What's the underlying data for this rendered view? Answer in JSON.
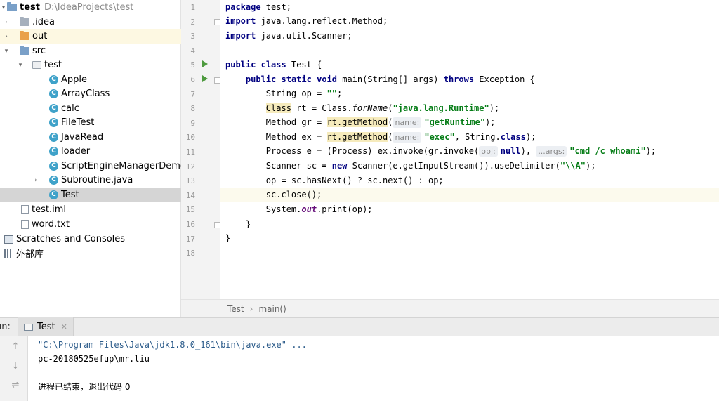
{
  "project_tree": {
    "root": {
      "name": "test",
      "path": "D:\\IdeaProjects\\test"
    },
    "items": [
      {
        "label": ".idea"
      },
      {
        "label": "out"
      },
      {
        "label": "src"
      },
      {
        "label": "test"
      },
      {
        "label": "Apple"
      },
      {
        "label": "ArrayClass"
      },
      {
        "label": "calc"
      },
      {
        "label": "FileTest"
      },
      {
        "label": "JavaRead"
      },
      {
        "label": "loader"
      },
      {
        "label": "ScriptEngineManagerDemo"
      },
      {
        "label": "Subroutine.java"
      },
      {
        "label": "Test"
      },
      {
        "label": "test.iml"
      },
      {
        "label": "word.txt"
      },
      {
        "label": "Scratches and Consoles"
      },
      {
        "label": "外部库"
      }
    ],
    "class_icon_letter": "C"
  },
  "editor": {
    "line_numbers": [
      "1",
      "2",
      "3",
      "4",
      "5",
      "6",
      "7",
      "8",
      "9",
      "10",
      "11",
      "12",
      "13",
      "14",
      "15",
      "16",
      "17",
      "18"
    ],
    "code": {
      "l1_kw": "package",
      "l1_rest": " test;",
      "l2_kw": "import",
      "l2_rest": " java.lang.reflect.Method;",
      "l3_kw": "import",
      "l3_rest": " java.util.Scanner;",
      "l5_kw1": "public",
      "l5_kw2": "class",
      "l5_rest": " Test {",
      "l6_kw1": "public",
      "l6_kw2": "static",
      "l6_kw3": "void",
      "l6_mid": " main(String[] args) ",
      "l6_kw4": "throws",
      "l6_rest": " Exception {",
      "l7_a": "String op = ",
      "l7_str": "\"\"",
      "l7_b": ";",
      "l8_hl": "Class",
      "l8_a": " rt = Class.",
      "l8_it": "forName",
      "l8_b": "(",
      "l8_str": "\"java.lang.Runtime\"",
      "l8_c": ");",
      "l9_a": "Method gr = ",
      "l9_hl": "rt.getMethod",
      "l9_b": "(",
      "l9_hint": "name:",
      "l9_str": "\"getRuntime\"",
      "l9_c": ");",
      "l10_a": "Method ex = ",
      "l10_hl": "rt.getMethod",
      "l10_b": "(",
      "l10_hint": "name:",
      "l10_str": "\"exec\"",
      "l10_c": ", String.",
      "l10_kw": "class",
      "l10_d": ");",
      "l11_a": "Process e = (Process) ex.invoke(gr.invoke(",
      "l11_hint1": "obj:",
      "l11_kw": "null",
      "l11_b": "), ",
      "l11_hint2": "...args:",
      "l11_str1": "\"cmd /c ",
      "l11_str2": "whoami",
      "l11_str3": "\"",
      "l11_c": ");",
      "l12_a": "Scanner sc = ",
      "l12_kw": "new",
      "l12_b": " Scanner(e.getInputStream()).useDelimiter(",
      "l12_str": "\"\\\\A\"",
      "l12_c": ");",
      "l13_a": "op = sc.hasNext() ? sc.next() : op;",
      "l14_a": "sc.close();",
      "l15_a": "System.",
      "l15_it": "out",
      "l15_b": ".print(op);",
      "l16_a": "}",
      "l17_a": "}"
    }
  },
  "breadcrumb": {
    "items": [
      "Test",
      "main()"
    ],
    "separator": "›"
  },
  "run_panel": {
    "label": "un:",
    "tab": "Test",
    "tab_close": "✕",
    "toolbar_icons": [
      "arrow-up-icon",
      "arrow-down-icon",
      "wrap-icon"
    ],
    "console_lines": [
      "\"C:\\Program Files\\Java\\jdk1.8.0_161\\bin\\java.exe\" ...",
      "pc-20180525efup\\mr.liu",
      "进程已结束，退出代码 0"
    ]
  },
  "colors": {
    "keyword": "#000080",
    "string": "#067d17",
    "selection": "#d5d5d5",
    "class_icon": "#3fa2c9",
    "run_icon": "#4d9a3e"
  }
}
